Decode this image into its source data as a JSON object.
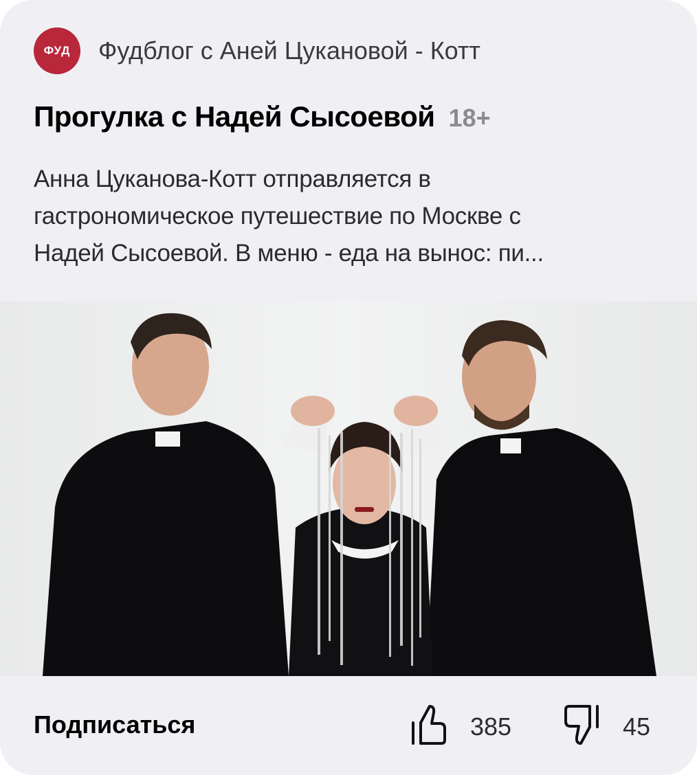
{
  "channel": {
    "avatar_text": "ФУД",
    "avatar_color": "#b8273a",
    "name": "Фудблог с Аней Цукановой - Котт"
  },
  "post": {
    "title": "Прогулка с Надей Сысоевой",
    "age_rating": "18+",
    "description_lines": [
      "Анна Цуканова-Котт отправляется в",
      "гастрономическое путешествие по Москве с",
      "Надей Сысоевой. В меню - еда на вынос: пи..."
    ],
    "media_icon": "video-thumbnail"
  },
  "footer": {
    "subscribe_label": "Подписаться",
    "likes": "385",
    "dislikes": "45",
    "like_icon": "thumb-up-icon",
    "dislike_icon": "thumb-down-icon"
  }
}
